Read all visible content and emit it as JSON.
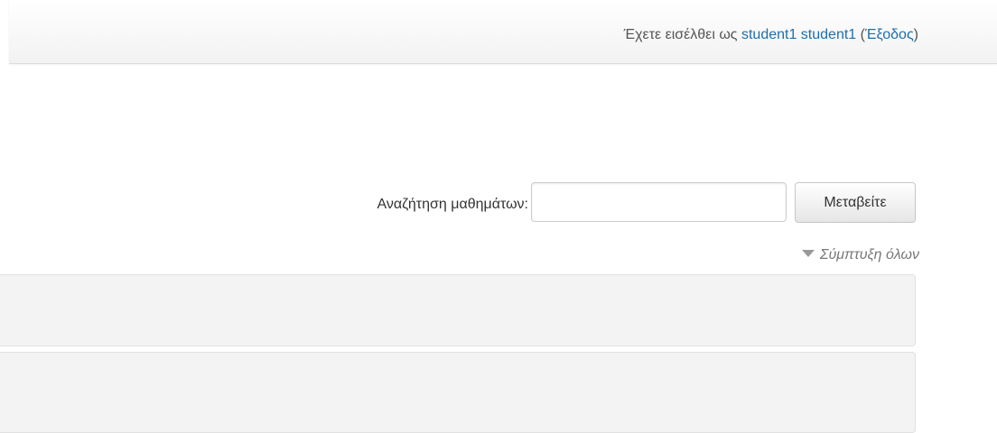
{
  "header": {
    "login_prefix": "Έχετε εισέλθει ως",
    "user_name": "student1 student1",
    "logout_open": "(",
    "logout_label": "Έξοδος",
    "logout_close": ")"
  },
  "search": {
    "label": "Αναζήτηση μαθημάτων:",
    "input_value": "",
    "button_label": "Μεταβείτε"
  },
  "categories": {
    "collapse_all_label": "Σύμπτυξη όλων",
    "collapse_icon": "triangle-down-icon"
  }
}
